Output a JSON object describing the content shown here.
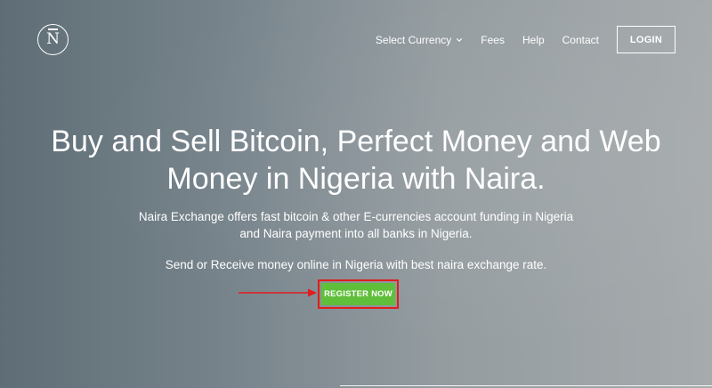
{
  "logo": {
    "mark": "N",
    "icon": "naira-logo-icon"
  },
  "nav": {
    "currency_label": "Select Currency",
    "fees_label": "Fees",
    "help_label": "Help",
    "contact_label": "Contact",
    "login_label": "LOGIN"
  },
  "hero": {
    "headline_line1": "Buy and Sell Bitcoin, Perfect Money and Web",
    "headline_line2": "Money in Nigeria with Naira.",
    "desc_line1": "Naira Exchange offers fast bitcoin & other E-currencies account funding in Nigeria",
    "desc_line2": "and Naira payment into all banks in Nigeria.",
    "desc2": "Send or Receive money online in Nigeria with best naira exchange rate.",
    "register_label": "REGISTER NOW"
  },
  "colors": {
    "register_green": "#5fbf3a",
    "highlight_red": "#e21c1c",
    "text": "#ffffff"
  }
}
